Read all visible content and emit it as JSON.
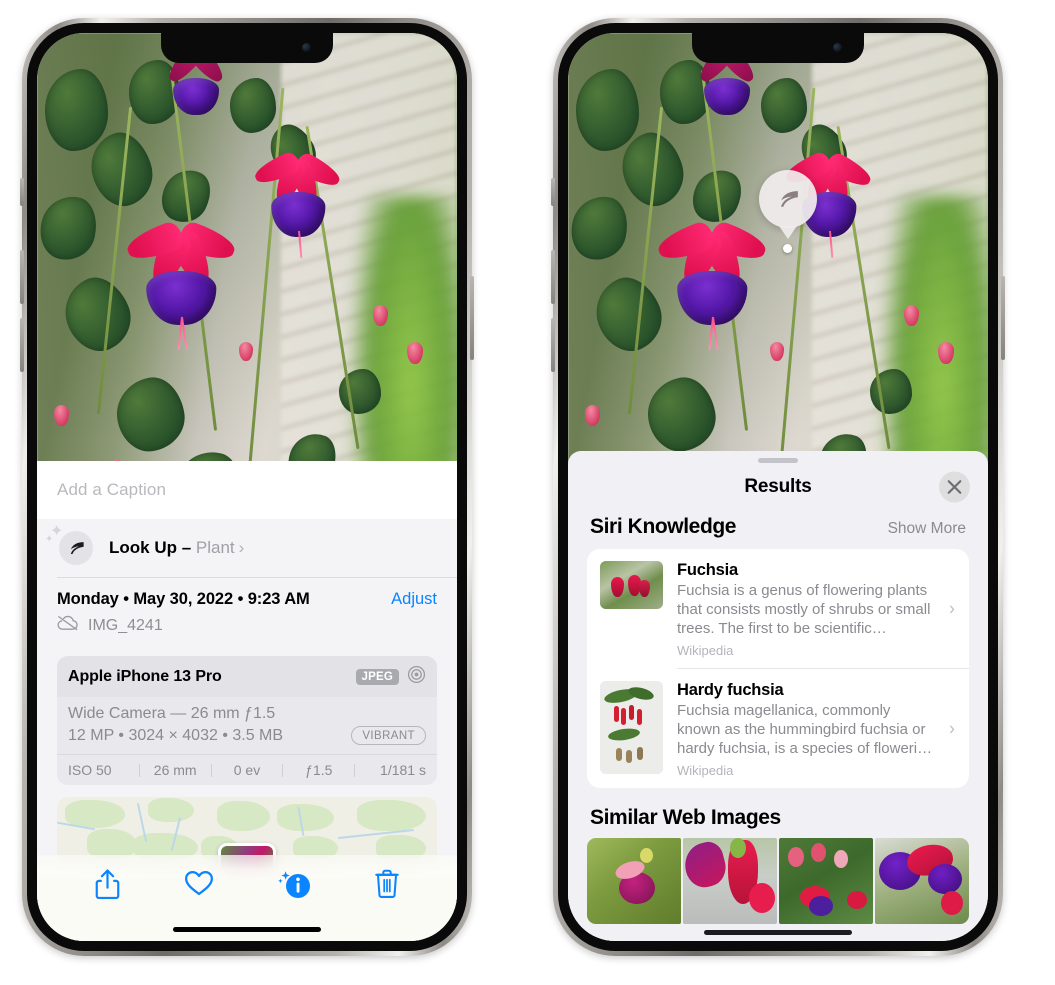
{
  "left_phone": {
    "caption_placeholder": "Add a Caption",
    "lookup": {
      "label": "Look Up – ",
      "subject": "Plant",
      "chevron": "›",
      "icon": "leaf-icon"
    },
    "date_text": "Monday • May 30, 2022 • 9:23 AM",
    "adjust_label": "Adjust",
    "file_name": "IMG_4241",
    "cloud_icon": "cloud-slash-icon",
    "camera": {
      "model": "Apple iPhone 13 Pro",
      "format_badge": "JPEG",
      "aperture_icon": "aperture-icon",
      "lens_line": "Wide Camera — 26 mm ƒ1.5",
      "specs_line": "12 MP • 3024 × 4032 • 3.5 MB",
      "vibrant_badge": "VIBRANT",
      "exif": [
        "ISO 50",
        "26 mm",
        "0 ev",
        "ƒ1.5",
        "1/181 s"
      ]
    },
    "toolbar": [
      {
        "name": "share-button",
        "icon": "share-icon"
      },
      {
        "name": "favorite-button",
        "icon": "heart-icon"
      },
      {
        "name": "info-button",
        "icon": "info-sparkle-icon"
      },
      {
        "name": "delete-button",
        "icon": "trash-icon"
      }
    ]
  },
  "right_phone": {
    "badge": {
      "icon": "leaf-icon"
    },
    "sheet": {
      "title": "Results",
      "close_icon": "close-icon",
      "siri_knowledge": {
        "heading": "Siri Knowledge",
        "show_more": "Show More",
        "items": [
          {
            "title": "Fuchsia",
            "description": "Fuchsia is a genus of flowering plants that consists mostly of shrubs or small trees. The first to be scientific…",
            "source": "Wikipedia",
            "chevron": "›"
          },
          {
            "title": "Hardy fuchsia",
            "description": "Fuchsia magellanica, commonly known as the hummingbird fuchsia or hardy fuchsia, is a species of floweri…",
            "source": "Wikipedia",
            "chevron": "›"
          }
        ]
      },
      "similar_web_images": {
        "heading": "Similar Web Images",
        "count": 4
      }
    }
  },
  "colors": {
    "accent_blue": "#0a84ff",
    "sheet_gray": "#f1f1f5",
    "card_white": "#ffffff",
    "secondary_text": "#8a8a90"
  }
}
